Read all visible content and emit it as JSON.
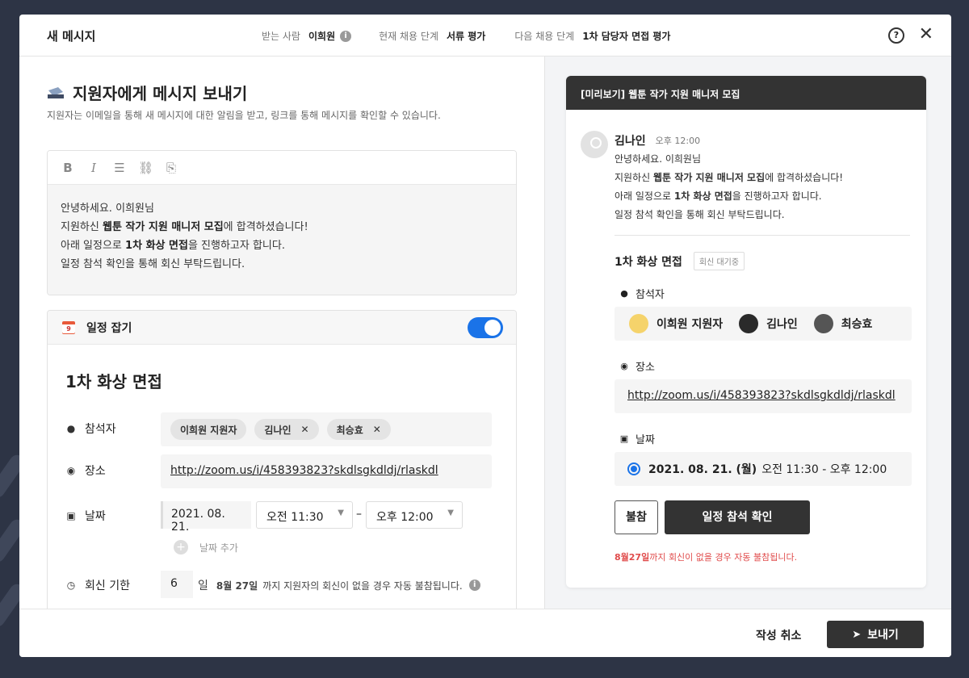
{
  "header": {
    "title": "새 메시지",
    "recipient_label": "받는 사람",
    "recipient": "이희원",
    "stage_label": "현재 채용 단계",
    "stage": "서류 평가",
    "next_stage_label": "다음 채용 단계",
    "next_stage": "1차 담당자 면접 평가",
    "help_icon": "question-circle-icon",
    "close_icon": "close-icon"
  },
  "compose": {
    "title": "지원자에게 메시지 보내기",
    "subtitle": "지원자는 이메일을 통해 새 메시지에 대한 알림을 받고, 링크를 통해 메시지를 확인할 수 있습니다.",
    "toolbar": [
      "bold-icon",
      "italic-icon",
      "list-icon",
      "link-icon",
      "attach-file-icon"
    ],
    "body": {
      "line1": "안녕하세요. 이희원님",
      "line2_pre": "지원하신 ",
      "line2_bold": "웹툰 작가 지원 매니저 모집",
      "line2_post": "에 합격하셨습니다!",
      "line3_pre": "아래 일정으로 ",
      "line3_bold": "1차 화상 면접",
      "line3_post": "을 진행하고자 합니다.",
      "line4": "일정 참석 확인을 통해 회신 부탁드립니다."
    }
  },
  "schedule": {
    "header": "일정 잡기",
    "toggle_on": true,
    "event_title": "1차 화상 면접",
    "attendees_label": "참석자",
    "attendees": [
      {
        "name": "이희원 지원자",
        "removable": false
      },
      {
        "name": "김나인",
        "removable": true
      },
      {
        "name": "최승효",
        "removable": true
      }
    ],
    "location_label": "장소",
    "location": "http://zoom.us/i/458393823?skdlsgkdldj/rlaskdl",
    "date_label": "날짜",
    "date": "2021. 08. 21.",
    "start_time": "오전 11:30",
    "end_time": "오후 12:00",
    "add_date": "날짜 추가",
    "deadline_label": "회신 기한",
    "deadline_days": "6",
    "deadline_unit": "일",
    "deadline_bold": "8월 27일",
    "deadline_text": "까지 지원자의 회신이 없을 경우 자동 불참됩니다."
  },
  "preview": {
    "header": "[미리보기] 웹툰 작가 지원 매니저 모집",
    "sender": "김나인",
    "time": "오후 12:00",
    "event_title": "1차 화상 면접",
    "badge": "회신 대기중",
    "attendees_label": "참석자",
    "attendees": [
      "이희원 지원자",
      "김나인",
      "최승효"
    ],
    "location_label": "장소",
    "location": "http://zoom.us/i/458393823?skdlsgkdldj/rlaskdl",
    "date_label": "날짜",
    "date_bold": "2021. 08. 21. (월)",
    "date_time": "오전 11:30 - 오후 12:00",
    "decline_btn": "불참",
    "confirm_btn": "일정 참석 확인",
    "warn_bold": "8월27일",
    "warn_text": "까지 회신이 없을 경우 자동 불참됩니다."
  },
  "footer": {
    "cancel": "작성 취소",
    "send": "보내기"
  },
  "colors": {
    "accent": "#1a73e8",
    "dark": "#333333",
    "warning": "#e04c4c"
  }
}
